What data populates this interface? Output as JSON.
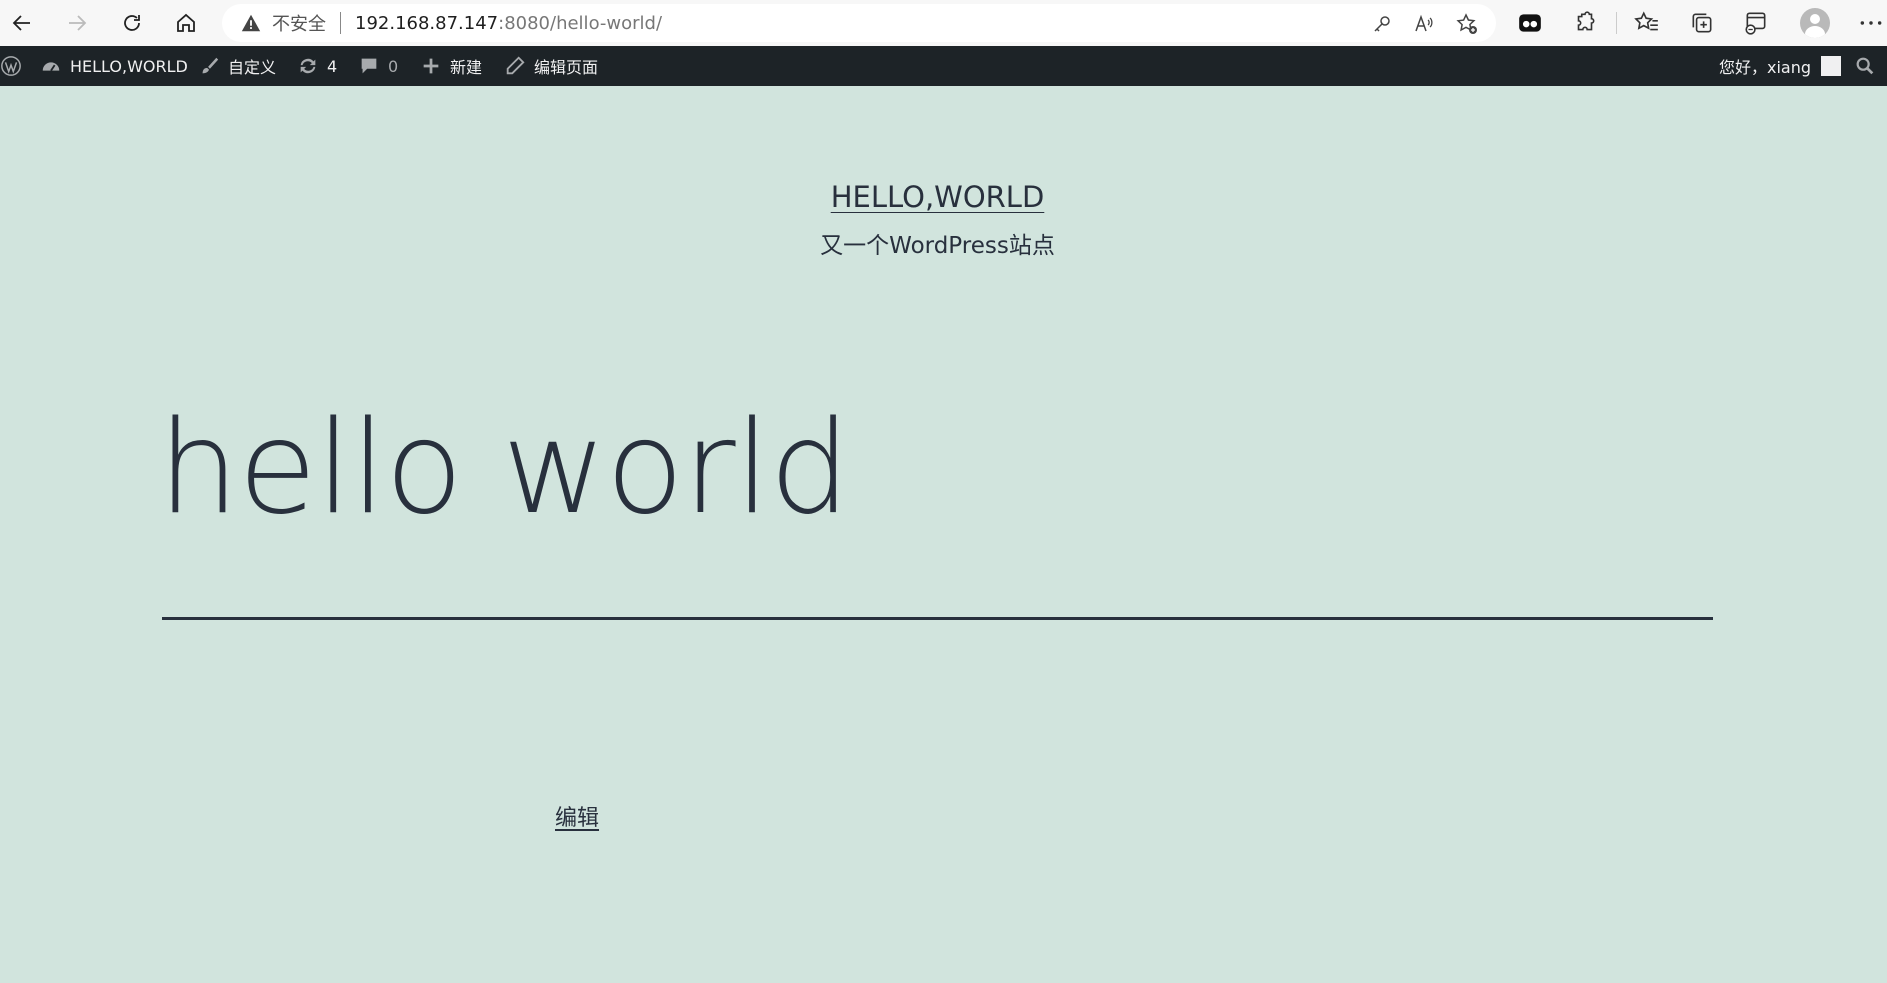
{
  "browser": {
    "insecure_label": "不安全",
    "url_host": "192.168.87.147",
    "url_rest": ":8080/hello-world/"
  },
  "admin_bar": {
    "site_name": "HELLO,WORLD",
    "customize": "自定义",
    "updates_count": "4",
    "comments_count": "0",
    "new_label": "新建",
    "edit_page": "编辑页面",
    "greeting": "您好，xiang"
  },
  "site": {
    "title": "HELLO,WORLD",
    "description": "又一个WordPress站点"
  },
  "post": {
    "title": "hello world",
    "edit_link": "编辑"
  },
  "colors": {
    "page_background": "#d1e4dd",
    "text": "#28303d",
    "admin_bar": "#1d2327"
  }
}
